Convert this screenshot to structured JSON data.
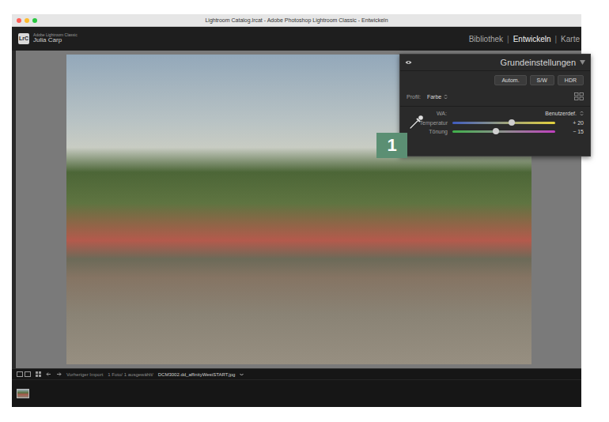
{
  "window": {
    "title": "Lightroom Catalog.lrcat - Adobe Photoshop Lightroom Classic - Entwickeln"
  },
  "header": {
    "logo": "LrC",
    "app": "Adobe Lightroom Classic",
    "user": "Julia Carp",
    "separator": "|",
    "modules": [
      {
        "label": "Bibliothek",
        "selected": false
      },
      {
        "label": "Entwickeln",
        "selected": true
      },
      {
        "label": "Karte",
        "selected": false
      }
    ]
  },
  "panel": {
    "title": "Grundeinstellungen",
    "buttons": [
      "Autom.",
      "S/W",
      "HDR"
    ],
    "profile": {
      "label": "Profil:",
      "value": "Farbe"
    },
    "wb": {
      "label": "WA:",
      "value": "Benutzerdef."
    },
    "sliders": [
      {
        "label": "Temperatur",
        "kind": "temperature",
        "level": 0.58,
        "reading": "+ 20"
      },
      {
        "label": "Tönung",
        "kind": "tint",
        "level": 0.42,
        "reading": "− 15"
      }
    ]
  },
  "callout": {
    "label": "1"
  },
  "filmstrip": {
    "source": "Vorheriger Import",
    "count": "1 Foto/ 1 ausgewählt/",
    "file": "DCM3002.dd_affinityWestSTART.jpg"
  }
}
